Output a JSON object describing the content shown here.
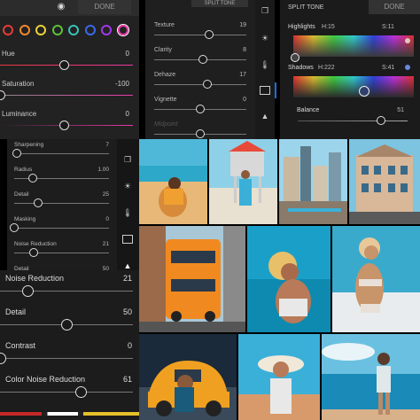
{
  "color_panel": {
    "done_label": "DONE",
    "swatch_colors": [
      "#e83a3a",
      "#f28a2a",
      "#e8d23a",
      "#5cc23a",
      "#3ac2b6",
      "#3a6ae8",
      "#a23ae8",
      "#e83aa8"
    ],
    "sliders": [
      {
        "label": "Hue",
        "value": "0",
        "level": 0.48
      },
      {
        "label": "Saturation",
        "value": "-100",
        "level": 0.0
      },
      {
        "label": "Luminance",
        "value": "0",
        "level": 0.48
      }
    ]
  },
  "light_panel": {
    "header_label": "SPLIT TONE",
    "sliders": [
      {
        "label": "Texture",
        "value": "19",
        "level": 0.6
      },
      {
        "label": "Clarity",
        "value": "8",
        "level": 0.53
      },
      {
        "label": "Dehaze",
        "value": "17",
        "level": 0.58
      },
      {
        "label": "Vignette",
        "value": "0",
        "level": 0.5
      },
      {
        "label": "Midpoint",
        "value": "",
        "level": 0.5
      }
    ]
  },
  "split_tone_panel": {
    "title": "SPLIT TONE",
    "done_label": "DONE",
    "highlights_label": "Highlights",
    "highlights_hue": "H:15",
    "highlights_sat": "S:11",
    "shadows_label": "Shadows",
    "shadows_hue": "H:222",
    "shadows_sat": "S:41",
    "balance_label": "Balance",
    "balance_value": "51",
    "balance_level": 0.76
  },
  "detail_panel": {
    "sliders": [
      {
        "label": "Sharpening",
        "value": "7",
        "level": 0.03
      },
      {
        "label": "Radius",
        "value": "1.00",
        "level": 0.2
      },
      {
        "label": "Detail",
        "value": "25",
        "level": 0.25
      },
      {
        "label": "Masking",
        "value": "0",
        "level": 0.0
      },
      {
        "label": "Noise Reduction",
        "value": "21",
        "level": 0.21
      },
      {
        "label": "Detail",
        "value": "50",
        "level": 0.5
      }
    ]
  },
  "large_panel": {
    "sliders": [
      {
        "label": "Noise Reduction",
        "value": "21",
        "level": 0.21
      },
      {
        "label": "Detail",
        "value": "50",
        "level": 0.5
      },
      {
        "label": "Contrast",
        "value": "0",
        "level": 0.0
      },
      {
        "label": "Color Noise Reduction",
        "value": "61",
        "level": 0.61
      }
    ]
  },
  "photos": [
    {
      "name": "beach-girl-photo",
      "subject": "woman on sand"
    },
    {
      "name": "lifeguard-tower-photo",
      "subject": "lifeguard tower"
    },
    {
      "name": "city-skyline-photo",
      "subject": "city buildings"
    },
    {
      "name": "historic-building-photo",
      "subject": "building"
    },
    {
      "name": "red-bus-photo",
      "subject": "double decker bus"
    },
    {
      "name": "water-portrait-photo",
      "subject": "woman in water"
    },
    {
      "name": "bikini-boat-photo",
      "subject": "woman on boat"
    },
    {
      "name": "yellow-car-photo",
      "subject": "yellow car"
    },
    {
      "name": "sunhat-photo",
      "subject": "woman in sun hat"
    },
    {
      "name": "sea-swimsuit-photo",
      "subject": "woman at sea"
    }
  ]
}
